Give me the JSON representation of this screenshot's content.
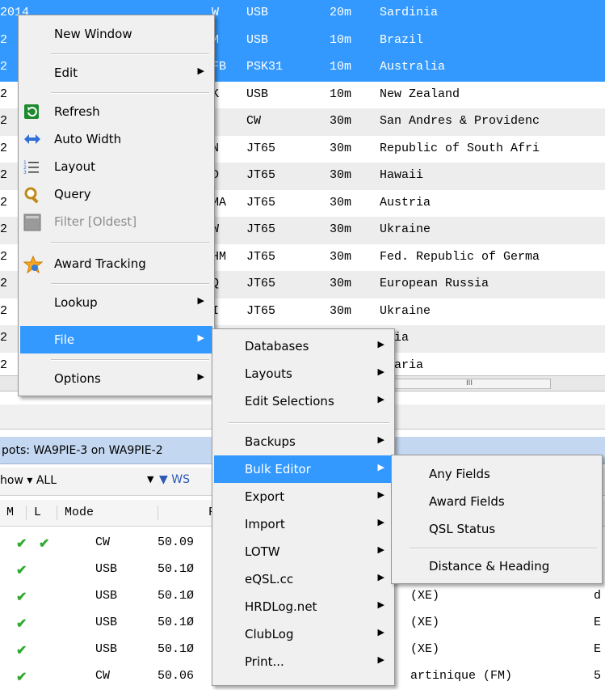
{
  "log_rows": [
    {
      "c1": "2014",
      "c2": "W",
      "mode": "USB",
      "band": "20m",
      "country": "Sardinia",
      "style": "sel"
    },
    {
      "c1": "2",
      "c2": "M",
      "mode": "USB",
      "band": "10m",
      "country": "Brazil",
      "style": "sel"
    },
    {
      "c1": "2",
      "c2": "FB",
      "mode": "PSK31",
      "band": "10m",
      "country": "Australia",
      "style": "sel"
    },
    {
      "c1": "2",
      "c2": "K",
      "mode": "USB",
      "band": "10m",
      "country": "New Zealand",
      "style": ""
    },
    {
      "c1": "2",
      "c2": "",
      "mode": "CW",
      "band": "30m",
      "country": "San Andres & Providenc",
      "style": "alt"
    },
    {
      "c1": "2",
      "c2": "N",
      "mode": "JT65",
      "band": "30m",
      "country": "Republic of South Afri",
      "style": ""
    },
    {
      "c1": "2",
      "c2": "D",
      "mode": "JT65",
      "band": "30m",
      "country": "Hawaii",
      "style": "alt"
    },
    {
      "c1": "2",
      "c2": "MA",
      "mode": "JT65",
      "band": "30m",
      "country": "Austria",
      "style": ""
    },
    {
      "c1": "2",
      "c2": "W",
      "mode": "JT65",
      "band": "30m",
      "country": "Ukraine",
      "style": "alt"
    },
    {
      "c1": "2",
      "c2": "HM",
      "mode": "JT65",
      "band": "30m",
      "country": "Fed. Republic of Germa",
      "style": ""
    },
    {
      "c1": "2",
      "c2": "Q",
      "mode": "JT65",
      "band": "30m",
      "country": "European Russia",
      "style": "alt"
    },
    {
      "c1": "2",
      "c2": "I",
      "mode": "JT65",
      "band": "30m",
      "country": "Ukraine",
      "style": ""
    },
    {
      "c1": "2",
      "c2": "",
      "mode": "",
      "band": "",
      "country": "tvia",
      "style": "alt"
    },
    {
      "c1": "2",
      "c2": "",
      "mode": "",
      "band": "",
      "country": "lgaria",
      "style": ""
    }
  ],
  "scroll_thumb": "III",
  "spots": {
    "title": "pots: WA9PIE-3 on WA9PIE-2",
    "show_label": "how ▾ ALL",
    "filter_label": "WS",
    "headers": {
      "m": "M",
      "l": "L",
      "mode": "Mode",
      "freq": "F"
    },
    "rows": [
      {
        "m": "✔",
        "l": "✔",
        "mode": "CW",
        "freq": "50.09",
        "country": "",
        "extra": ""
      },
      {
        "m": "✔",
        "l": "",
        "mode": "USB",
        "freq": "50.1Ø",
        "country": "",
        "extra": ""
      },
      {
        "m": "✔",
        "l": "",
        "mode": "USB",
        "freq": "50.1Ø",
        "country": "(XE)",
        "extra": "d"
      },
      {
        "m": "✔",
        "l": "",
        "mode": "USB",
        "freq": "50.1Ø",
        "country": "(XE)",
        "extra": "E"
      },
      {
        "m": "✔",
        "l": "",
        "mode": "USB",
        "freq": "50.1Ø",
        "country": "(XE)",
        "extra": "E"
      },
      {
        "m": "✔",
        "l": "",
        "mode": "CW",
        "freq": "50.06",
        "country": "artinique (FM)",
        "extra": "5"
      }
    ]
  },
  "main_menu": {
    "new_window": "New Window",
    "edit": "Edit",
    "refresh": "Refresh",
    "auto_width": "Auto Width",
    "layout": "Layout",
    "query": "Query",
    "filter": "Filter [Oldest]",
    "award_tracking": "Award Tracking",
    "lookup": "Lookup",
    "file": "File",
    "options": "Options"
  },
  "file_menu": {
    "databases": "Databases",
    "layouts": "Layouts",
    "edit_selections": "Edit Selections",
    "backups": "Backups",
    "bulk_editor": "Bulk Editor",
    "export": "Export",
    "import": "Import",
    "lotw": "LOTW",
    "eqsl": "eQSL.cc",
    "hrdlog": "HRDLog.net",
    "clublog": "ClubLog",
    "print": "Print..."
  },
  "bulk_menu": {
    "any_fields": "Any Fields",
    "award_fields": "Award Fields",
    "qsl_status": "QSL Status",
    "distance_heading": "Distance & Heading"
  },
  "icons": {
    "refresh": "refresh-icon",
    "auto_width": "auto-width-icon",
    "layout": "layout-icon",
    "query": "magnifier-icon",
    "filter": "filter-icon",
    "award": "star-icon"
  },
  "colors": {
    "selection": "#3399ff",
    "menu_bg": "#f0f0f0",
    "check": "#2eaa2e"
  }
}
